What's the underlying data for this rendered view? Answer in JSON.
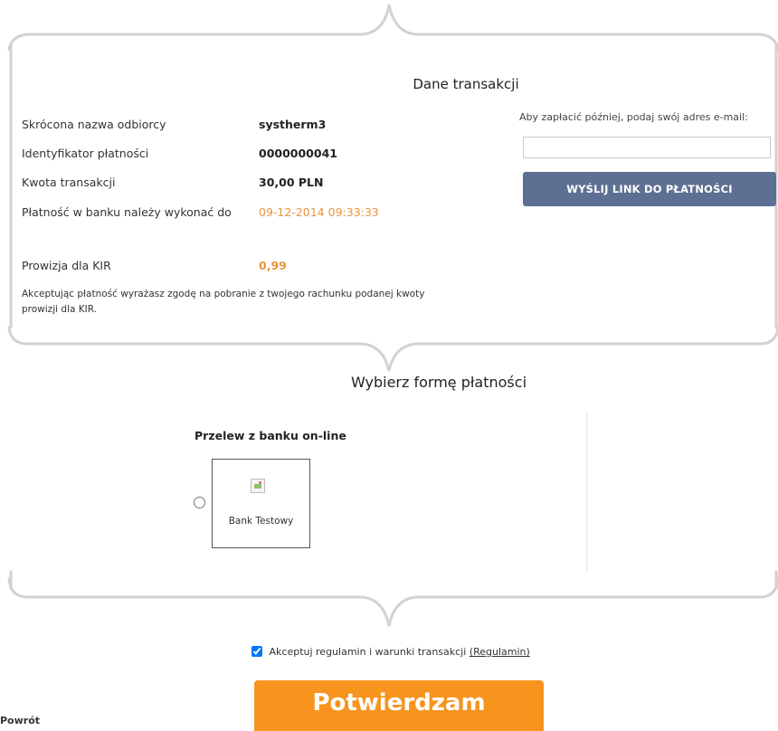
{
  "transaction": {
    "title": "Dane transakcji",
    "rows": [
      {
        "label": "Skrócona nazwa odbiorcy",
        "value": "systherm3"
      },
      {
        "label": "Identyfikator płatności",
        "value": "0000000041"
      },
      {
        "label": "Kwota transakcji",
        "value": "30,00 PLN"
      },
      {
        "label": "Płatność w banku należy wykonać do",
        "value": "09-12-2014 09:33:33"
      }
    ],
    "fee_label": "Prowizja dla KIR",
    "fee_value": "0,99",
    "note": "Akceptując płatność wyrażasz zgodę na pobranie z twojego rachunku podanej kwoty prowizji dla KIR."
  },
  "email": {
    "label": "Aby zapłacić później, podaj swój adres e-mail:",
    "value": "",
    "placeholder": "",
    "button_label": "WYŚLIJ LINK DO PŁATNOŚCI"
  },
  "payment": {
    "title": "Wybierz formę płatności",
    "method_title": "Przelew z banku on-line",
    "banks": [
      {
        "name": "Bank Testowy",
        "icon": "broken-image-icon"
      }
    ]
  },
  "terms": {
    "checked": true,
    "text": "Akceptuj regulamin i warunki transakcji",
    "link": "(Regulamin)"
  },
  "confirm_label": "Potwierdzam",
  "back_label": "Powrót",
  "colors": {
    "accent_orange": "#f7941d",
    "date_orange": "#e8943a",
    "button_blue": "#5d6f92",
    "frame_gray": "#cfcfcf"
  }
}
